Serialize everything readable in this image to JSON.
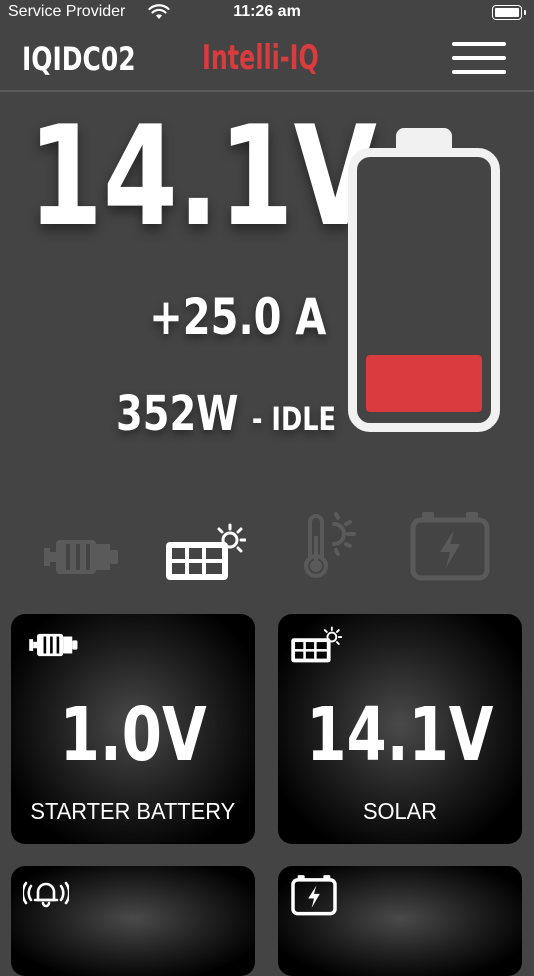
{
  "status_bar": {
    "carrier": "Service Provider",
    "time": "11:26 am",
    "wifi_icon": "wifi-icon",
    "battery_icon": "battery-full-icon"
  },
  "header": {
    "device_name": "IQIDC02",
    "brand": "Intelli-IQ",
    "menu_icon": "hamburger-menu-icon"
  },
  "colors": {
    "background": "#444444",
    "accent": "#d93b3e",
    "card": "#000000"
  },
  "main": {
    "voltage": "14.1V",
    "current": "+25.0 A",
    "power": "352W",
    "state": "- IDLE",
    "battery_level": 0.2
  },
  "sources": [
    {
      "name": "starter-battery",
      "icon": "engine-icon",
      "active": false
    },
    {
      "name": "solar",
      "icon": "solar-panel-icon",
      "active": true
    },
    {
      "name": "temperature",
      "icon": "thermometer-sun-icon",
      "active": false
    },
    {
      "name": "charging",
      "icon": "battery-charging-icon",
      "active": false
    }
  ],
  "cards": [
    {
      "icon": "engine-icon",
      "value": "1.0V",
      "label": "STARTER BATTERY"
    },
    {
      "icon": "solar-panel-icon",
      "value": "14.1V",
      "label": "SOLAR"
    },
    {
      "icon": "alarm-bell-icon",
      "value": "",
      "label": ""
    },
    {
      "icon": "battery-charging-icon",
      "value": "",
      "label": ""
    }
  ]
}
